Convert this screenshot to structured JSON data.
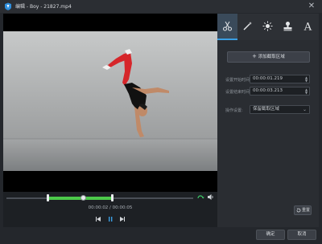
{
  "window": {
    "title": "编辑 - Boy - 21827.mp4",
    "close_glyph": "✕"
  },
  "preview": {
    "description_icon": "video-frame"
  },
  "timeline": {
    "timecode": "00:00:02 / 00:00:05",
    "range_start": 0.22,
    "range_end": 0.57,
    "playhead": 0.41
  },
  "tabs": [
    {
      "name": "scissors-icon",
      "active": true
    },
    {
      "name": "magic-wand-icon",
      "active": false
    },
    {
      "name": "brightness-icon",
      "active": false
    },
    {
      "name": "stamp-icon",
      "active": false
    },
    {
      "name": "text-icon",
      "active": false
    }
  ],
  "tab_text_glyph": "A",
  "panel": {
    "add_label": "添加截取区域",
    "start_label": "设置开始时间:",
    "start_value": "00:00:01.219",
    "end_label": "设置结束时间:",
    "end_value": "00:00:03.213",
    "mode_label": "操作设置:",
    "mode_value": "保留截取区域",
    "reset_label": "重置"
  },
  "footer": {
    "ok_label": "确定",
    "cancel_label": "取消"
  },
  "colors": {
    "accent": "#3b9fe3",
    "range": "#4cc94a",
    "background": "#24272c"
  }
}
